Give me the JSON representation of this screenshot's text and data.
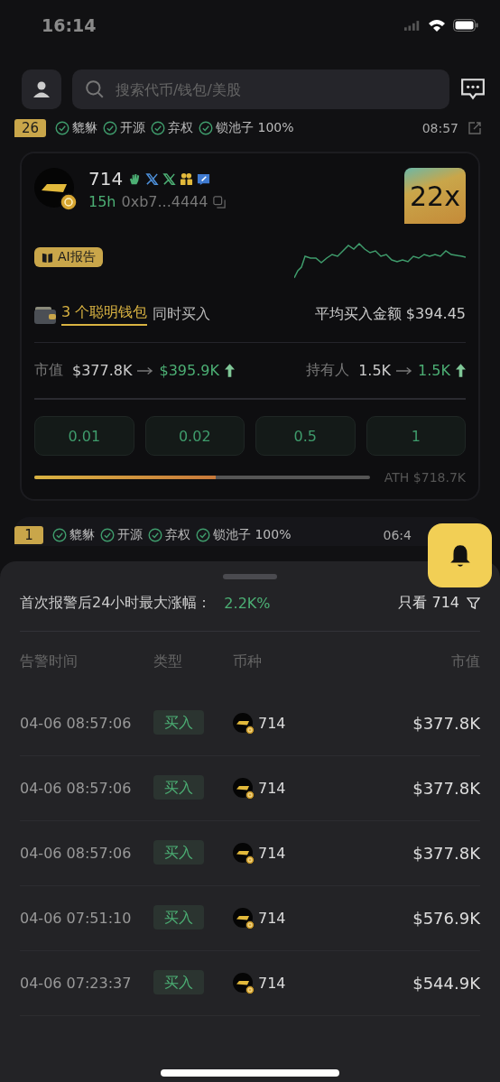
{
  "status_bar": {
    "time": "16:14"
  },
  "search": {
    "placeholder": "搜索代币/钱包/美股"
  },
  "alerts": [
    {
      "rank": "26",
      "checks": [
        {
          "label": "貔貅",
          "passed": true
        },
        {
          "label": "开源",
          "passed": true
        },
        {
          "label": "弃权",
          "passed": true
        },
        {
          "label": "锁池子 100%",
          "passed": true
        }
      ],
      "time": "08:57",
      "card": {
        "name": "714",
        "age": "15h",
        "address": "0xb7...4444",
        "multiplier": "22x",
        "ai_report": "AI报告",
        "smart_wallets": "3 个聪明钱包",
        "smart_suffix": "同时买入",
        "avg_buy": "平均买入金额 $394.45",
        "stats": [
          {
            "label": "市值",
            "from": "$377.8K",
            "to": "$395.9K"
          },
          {
            "label": "持有人",
            "from": "1.5K",
            "to": "1.5K"
          }
        ],
        "amounts": [
          "0.01",
          "0.02",
          "0.5",
          "1"
        ],
        "ath": {
          "level": 0.54,
          "label": "ATH $718.7K"
        }
      }
    },
    {
      "rank": "1",
      "checks": [
        {
          "label": "貔貅",
          "passed": true
        },
        {
          "label": "开源",
          "passed": true
        },
        {
          "label": "弃权",
          "passed": true
        },
        {
          "label": "锁池子 100%",
          "passed": true
        }
      ],
      "time": "06:4"
    }
  ],
  "sheet": {
    "summary_label": "首次报警后24小时最大涨幅：",
    "summary_value": "2.2K%",
    "filter": "只看 714",
    "columns": [
      "告警时间",
      "类型",
      "币种",
      "市值"
    ],
    "rows": [
      {
        "time": "04-06 08:57:06",
        "type": "买入",
        "token": "714",
        "market_cap": "$377.8K"
      },
      {
        "time": "04-06 08:57:06",
        "type": "买入",
        "token": "714",
        "market_cap": "$377.8K"
      },
      {
        "time": "04-06 08:57:06",
        "type": "买入",
        "token": "714",
        "market_cap": "$377.8K"
      },
      {
        "time": "04-06 07:51:10",
        "type": "买入",
        "token": "714",
        "market_cap": "$576.9K"
      },
      {
        "time": "04-06 07:23:37",
        "type": "买入",
        "token": "714",
        "market_cap": "$544.9K"
      }
    ]
  }
}
